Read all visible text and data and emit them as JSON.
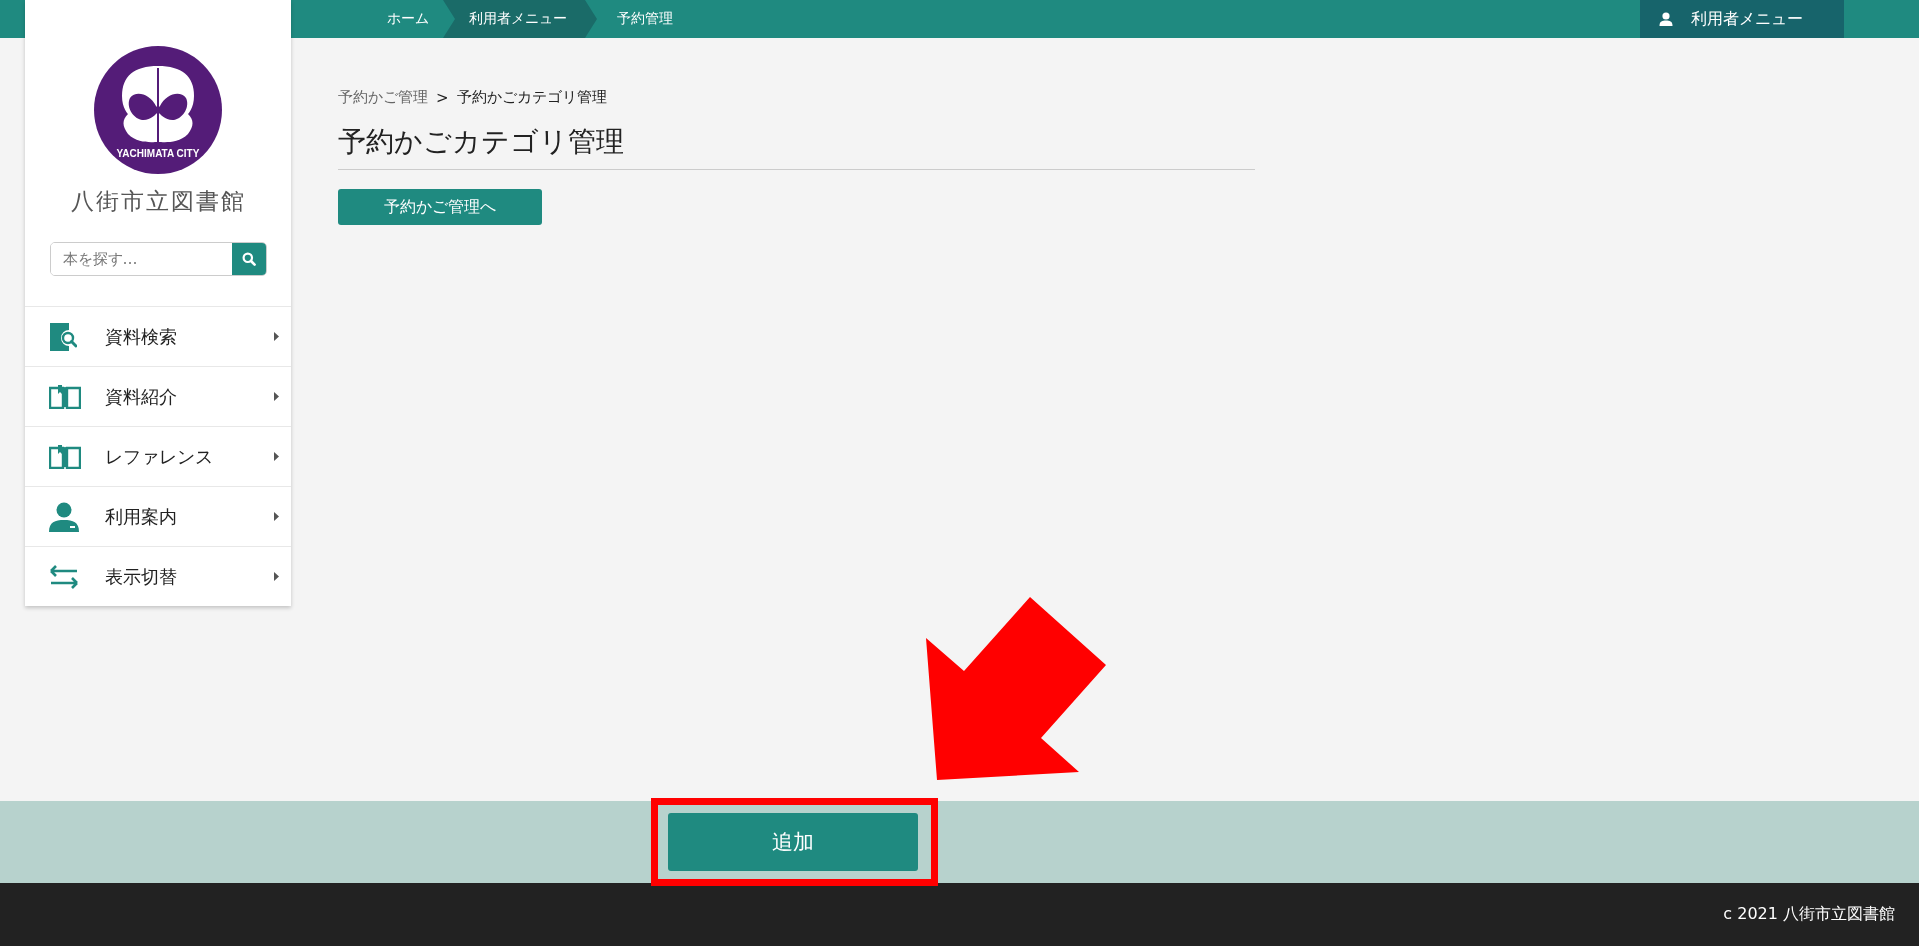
{
  "top_nav": {
    "breadcrumbs": [
      {
        "label": "ホーム",
        "selected": false
      },
      {
        "label": "利用者メニュー",
        "selected": true
      },
      {
        "label": "予約管理",
        "selected": false
      }
    ],
    "user_menu": "利用者メニュー"
  },
  "sidebar": {
    "logo_text": "YACHIMATA CITY",
    "library_name": "八街市立図書館",
    "search": {
      "placeholder": "本を探す…"
    },
    "menu": [
      {
        "label": "資料検索"
      },
      {
        "label": "資料紹介"
      },
      {
        "label": "レファレンス"
      },
      {
        "label": "利用案内"
      },
      {
        "label": "表示切替"
      }
    ]
  },
  "content": {
    "breadcrumb": {
      "parent": "予約かご管理",
      "separator": ">",
      "current": "予約かごカテゴリ管理"
    },
    "heading": "予約かごカテゴリ管理",
    "back_button": "予約かご管理へ"
  },
  "action_bar": {
    "button": "追加"
  },
  "footer": "c 2021 八街市立図書館"
}
